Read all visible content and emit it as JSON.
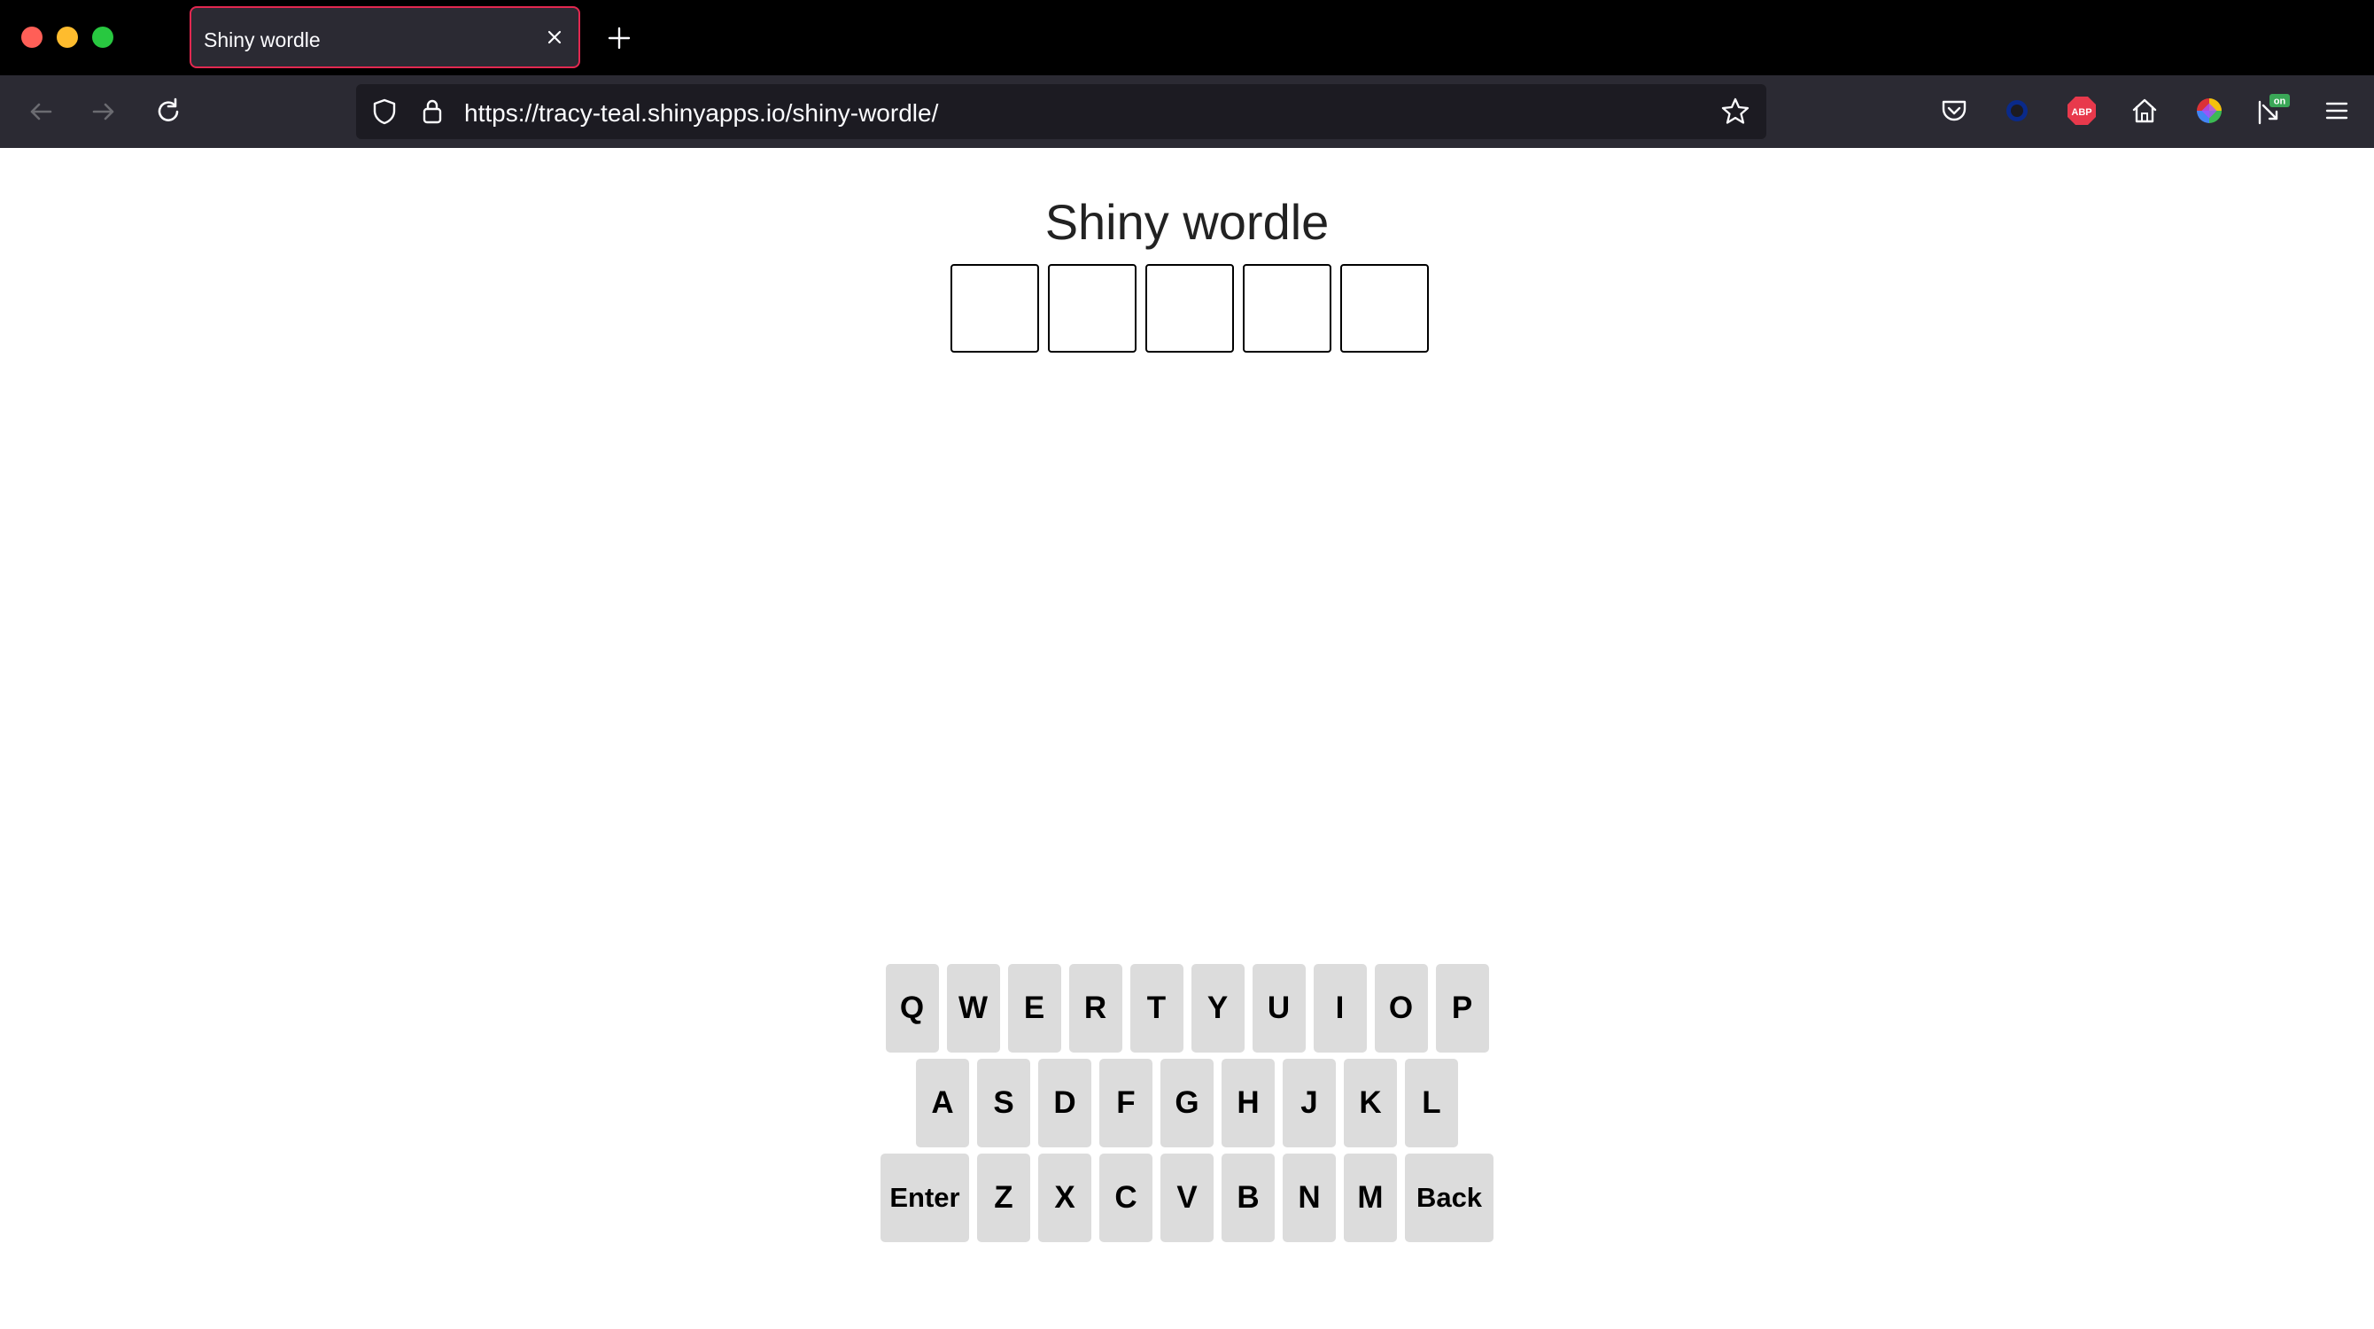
{
  "browser": {
    "tab": {
      "title": "Shiny wordle"
    },
    "url": "https://tracy-teal.shinyapps.io/shiny-wordle/",
    "colors": {
      "tab_accent": "#e22850",
      "toolbar_bg": "#2b2a33",
      "urlbar_bg": "#1c1b22"
    },
    "toolbar_icons": [
      "back-icon",
      "forward-icon",
      "reload-icon",
      "shield-icon",
      "lock-icon",
      "bookmark-star-icon",
      "pocket-icon",
      "extension-circle-icon",
      "adblock-icon",
      "home-icon",
      "color-picker-icon",
      "cursor-extension-icon",
      "menu-icon"
    ],
    "extensions": {
      "adblock_label": "ABP",
      "badge_label": "on"
    }
  },
  "page": {
    "title": "Shiny wordle",
    "board": {
      "guess": [
        "",
        "",
        "",
        "",
        ""
      ]
    },
    "keyboard": {
      "rows": [
        [
          "Q",
          "W",
          "E",
          "R",
          "T",
          "Y",
          "U",
          "I",
          "O",
          "P"
        ],
        [
          "A",
          "S",
          "D",
          "F",
          "G",
          "H",
          "J",
          "K",
          "L"
        ],
        [
          "Enter",
          "Z",
          "X",
          "C",
          "V",
          "B",
          "N",
          "M",
          "Back"
        ]
      ],
      "key_color": "#dcdcdc"
    }
  }
}
